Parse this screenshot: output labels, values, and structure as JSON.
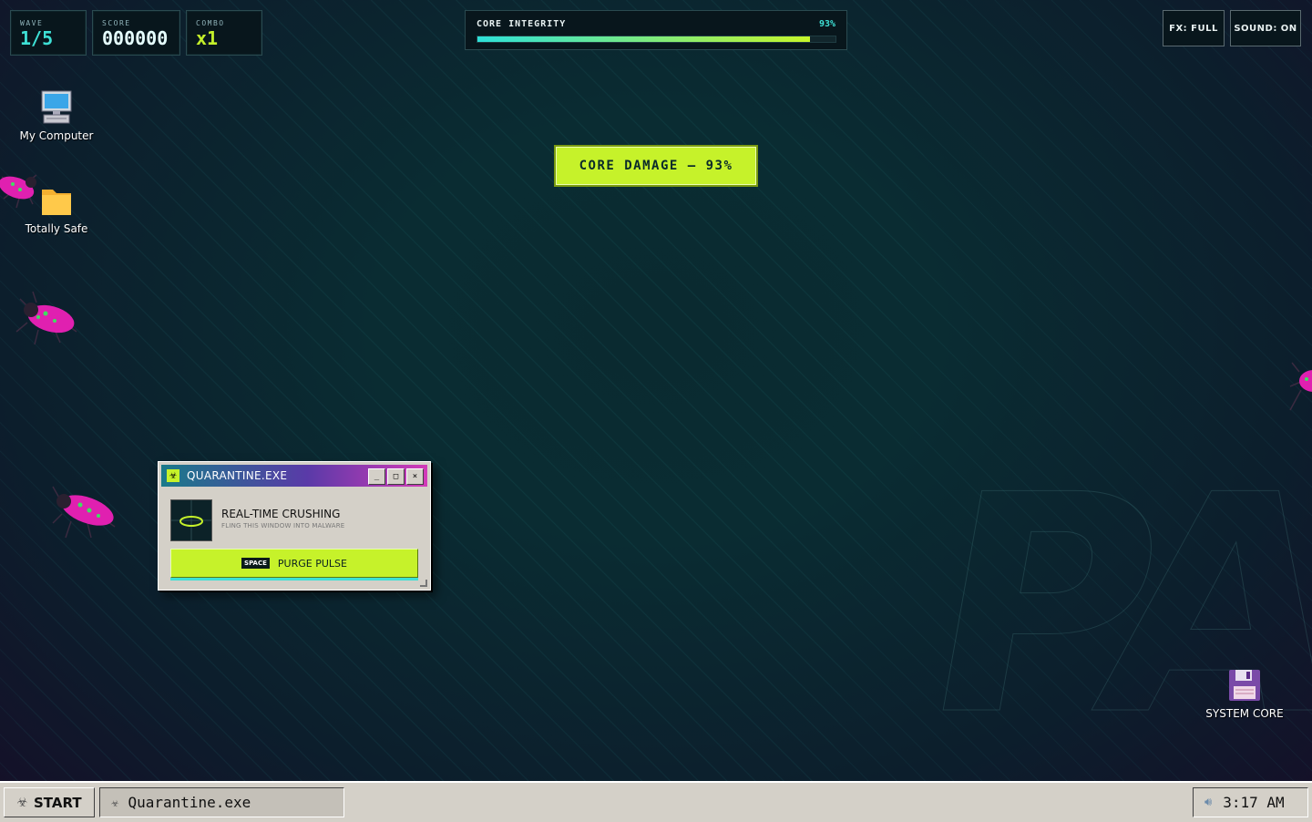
{
  "hud": {
    "wave": {
      "label": "WAVE",
      "value": "1/5"
    },
    "score": {
      "label": "SCORE",
      "value": "000000"
    },
    "combo": {
      "label": "COMBO",
      "value": "x1"
    },
    "integrity": {
      "label": "CORE INTEGRITY",
      "percent_text": "93%",
      "level": 0.93
    },
    "fx_label": "FX: FULL",
    "sound_label": "SOUND: ON"
  },
  "banner": {
    "text": "CORE DAMAGE — 93%"
  },
  "desktop_icons": [
    {
      "label": "My Computer",
      "icon": "computer-icon"
    },
    {
      "label": "Totally Safe",
      "icon": "folder-icon"
    },
    {
      "label": "SYSTEM CORE",
      "icon": "floppy-disk-icon"
    }
  ],
  "window": {
    "title": "QUARANTINE.EXE",
    "title_icon": "biohazard-icon",
    "heading": "REAL-TIME CRUSHING",
    "subheading": "FLING THIS WINDOW INTO MALWARE",
    "button_key": "SPACE",
    "button_label": "PURGE PULSE",
    "min_glyph": "_",
    "max_glyph": "□",
    "close_glyph": "×"
  },
  "taskbar": {
    "start_label": "START",
    "task_label": "Quarantine.exe",
    "clock": "3:17 AM"
  },
  "colors": {
    "accent_lime": "#c6f22a",
    "accent_cyan": "#3ee0d5",
    "bug_magenta": "#e020b0"
  }
}
